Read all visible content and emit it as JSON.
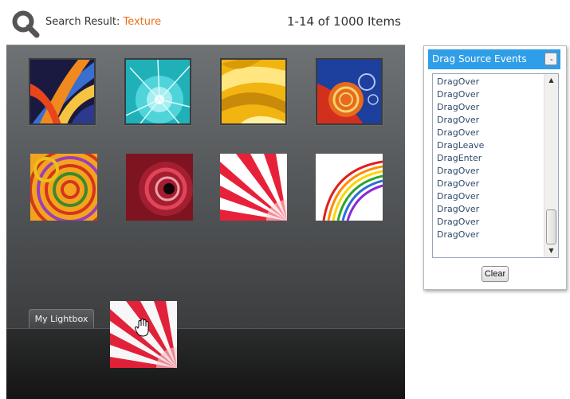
{
  "header": {
    "search_label": "Search Result: ",
    "search_term": "Texture",
    "item_count": "1-14 of 1000 Items",
    "search_icon": "magnifier-icon"
  },
  "gallery": {
    "thumbnails": [
      {
        "name": "thumbnail-orange-blue-streaks",
        "colors": [
          "#f08a1e",
          "#3a6fd0",
          "#1a1a40"
        ]
      },
      {
        "name": "thumbnail-teal-burst",
        "colors": [
          "#2bc2c8",
          "#b8f4f6",
          "#0a7f86"
        ]
      },
      {
        "name": "thumbnail-gold-waves",
        "colors": [
          "#f7c21a",
          "#fff1a0",
          "#b57a06"
        ]
      },
      {
        "name": "thumbnail-red-spiral",
        "colors": [
          "#d1301d",
          "#1d3f9e",
          "#f3a22b"
        ]
      },
      {
        "name": "thumbnail-rainbow-rings",
        "colors": [
          "#f2a41f",
          "#d5351c",
          "#3c8a2a"
        ]
      },
      {
        "name": "thumbnail-dark-red-swirl",
        "colors": [
          "#7d1420",
          "#e0455a",
          "#120508"
        ]
      },
      {
        "name": "thumbnail-pink-rays",
        "colors": [
          "#e8213a",
          "#ffd0d6",
          "#ffffff"
        ]
      },
      {
        "name": "thumbnail-rainbow-curves",
        "colors": [
          "#e41d1d",
          "#ffd400",
          "#2aa62a"
        ]
      }
    ]
  },
  "lightbox": {
    "tab_label": "My Lightbox",
    "cursor_icon": "hand-grab-icon"
  },
  "events_panel": {
    "title": "Drag Source Events",
    "collapse_label": "-",
    "events": [
      "DragOver",
      "DragOver",
      "DragOver",
      "DragOver",
      "DragOver",
      "DragLeave",
      "DragEnter",
      "DragOver",
      "DragOver",
      "DragOver",
      "DragOver",
      "DragOver",
      "DragOver"
    ],
    "clear_label": "Clear"
  },
  "colors": {
    "accent_orange": "#e8731e",
    "panel_header_blue": "#2f9ee8",
    "event_text": "#2d4a6b"
  }
}
